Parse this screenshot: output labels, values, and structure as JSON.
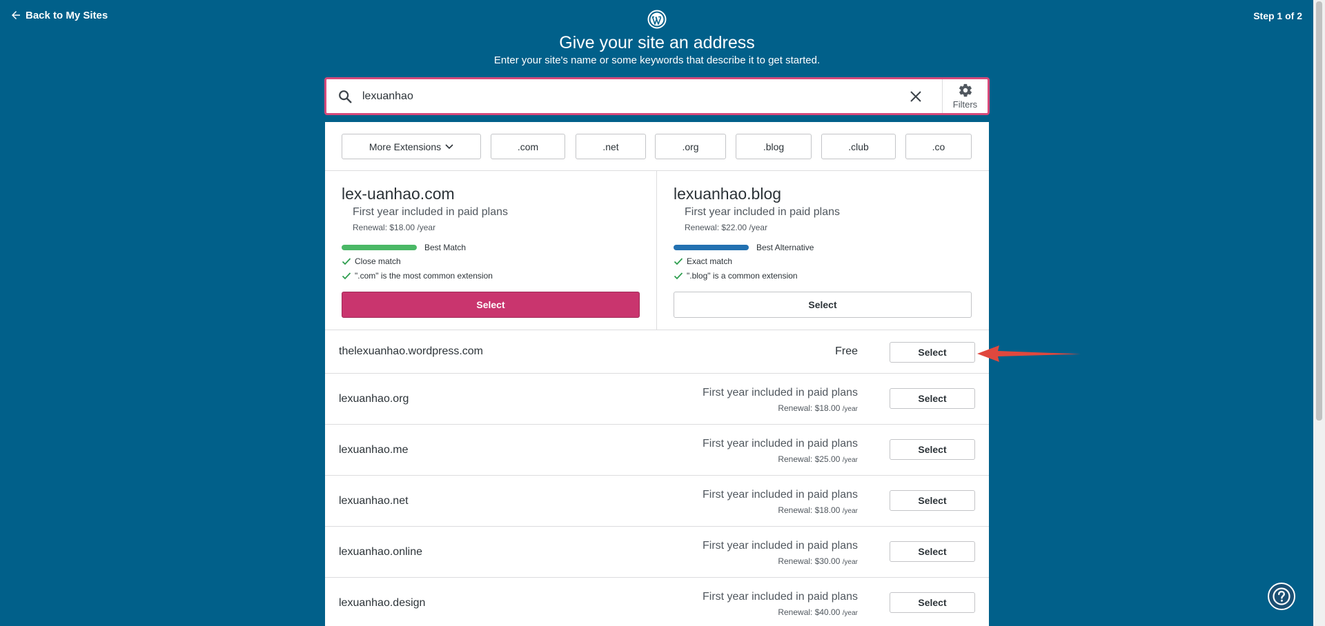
{
  "header": {
    "back_label": "Back to My Sites",
    "step_label": "Step 1 of 2",
    "title": "Give your site an address",
    "subtitle": "Enter your site's name or some keywords that describe it to get started."
  },
  "search": {
    "value": "lexuanhao",
    "filters_label": "Filters"
  },
  "extensions": {
    "more_label": "More Extensions",
    "items": [
      ".com",
      ".net",
      ".org",
      ".blog",
      ".club",
      ".co"
    ]
  },
  "featured": [
    {
      "domain": "lex-uanhao.com",
      "price": "First year included in paid plans",
      "renewal": "Renewal: $18.00 /year",
      "match_label": "Best Match",
      "match_color": "#4ab866",
      "reasons": [
        "Close match",
        "\".com\" is the most common extension"
      ],
      "select_label": "Select"
    },
    {
      "domain": "lexuanhao.blog",
      "price": "First year included in paid plans",
      "renewal": "Renewal: $22.00 /year",
      "match_label": "Best Alternative",
      "match_color": "#2271b1",
      "reasons": [
        "Exact match",
        "\".blog\" is a common extension"
      ],
      "select_label": "Select"
    }
  ],
  "free_row": {
    "domain": "thelexuanhao.wordpress.com",
    "price": "Free",
    "select_label": "Select"
  },
  "rows": [
    {
      "domain": "lexuanhao.org",
      "price": "First year included in paid plans",
      "renewal": "Renewal: $18.00",
      "period": "/year",
      "select_label": "Select"
    },
    {
      "domain": "lexuanhao.me",
      "price": "First year included in paid plans",
      "renewal": "Renewal: $25.00",
      "period": "/year",
      "select_label": "Select"
    },
    {
      "domain": "lexuanhao.net",
      "price": "First year included in paid plans",
      "renewal": "Renewal: $18.00",
      "period": "/year",
      "select_label": "Select"
    },
    {
      "domain": "lexuanhao.online",
      "price": "First year included in paid plans",
      "renewal": "Renewal: $30.00",
      "period": "/year",
      "select_label": "Select"
    },
    {
      "domain": "lexuanhao.design",
      "price": "First year included in paid plans",
      "renewal": "Renewal: $40.00",
      "period": "/year",
      "select_label": "Select"
    }
  ],
  "colors": {
    "background": "#01608a",
    "primary": "#c9356e",
    "arrow": "#e0483e"
  }
}
